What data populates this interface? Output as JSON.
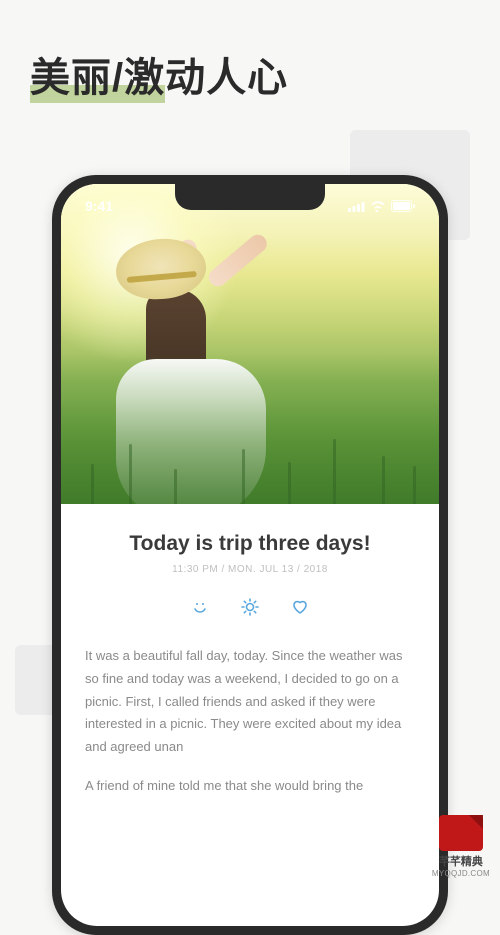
{
  "promo": {
    "headline": "美丽/激动人心"
  },
  "status": {
    "time": "9:41"
  },
  "entry": {
    "title": "Today is trip three days!",
    "meta": "11:30 PM / MON. JUL 13 / 2018",
    "body_p1": "It was a beautiful fall day, today. Since the weather was so fine and today was a weekend, I decided to go on a picnic. First, I called friends and asked if they were interested in a picnic. They were excited about my idea and agreed unan",
    "body_p2": "A friend of mine told me that she would bring the"
  },
  "watermark": {
    "cn": "芊芊精典",
    "en": "MYQQJD.COM"
  },
  "colors": {
    "icon_blue": "#5aa7dd"
  }
}
